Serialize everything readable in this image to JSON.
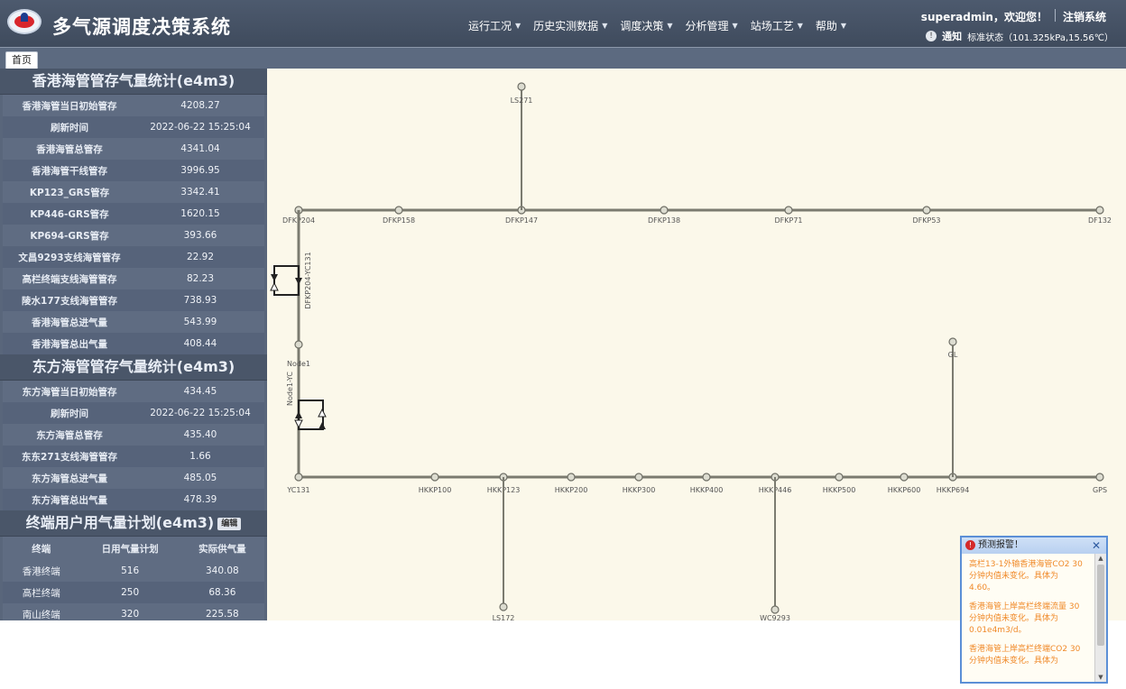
{
  "app": {
    "title": "多气源调度决策系统",
    "menu": [
      "运行工况",
      "历史实测数据",
      "调度决策",
      "分析管理",
      "站场工艺",
      "帮助"
    ],
    "user_greeting": "superadmin，欢迎您！",
    "logout_label": "注销系统",
    "notice_label": "通知",
    "status_text": "标准状态（101.325kPa,15.56℃）"
  },
  "tabs": [
    {
      "label": "首页"
    }
  ],
  "hk_panel": {
    "title": "香港海管管存气量统计(e4m3)",
    "rows": [
      {
        "label": "香港海管当日初始管存",
        "value": "4208.27"
      },
      {
        "label": "刷新时间",
        "value": "2022-06-22 15:25:04"
      },
      {
        "label": "香港海管总管存",
        "value": "4341.04"
      },
      {
        "label": "香港海管干线管存",
        "value": "3996.95"
      },
      {
        "label": "KP123_GRS管存",
        "value": "3342.41"
      },
      {
        "label": "KP446-GRS管存",
        "value": "1620.15"
      },
      {
        "label": "KP694-GRS管存",
        "value": "393.66"
      },
      {
        "label": "文昌9293支线海管管存",
        "value": "22.92"
      },
      {
        "label": "高栏终端支线海管管存",
        "value": "82.23"
      },
      {
        "label": "陵水177支线海管管存",
        "value": "738.93"
      },
      {
        "label": "香港海管总进气量",
        "value": "543.99"
      },
      {
        "label": "香港海管总出气量",
        "value": "408.44"
      }
    ]
  },
  "df_panel": {
    "title": "东方海管管存气量统计(e4m3)",
    "rows": [
      {
        "label": "东方海管当日初始管存",
        "value": "434.45"
      },
      {
        "label": "刷新时间",
        "value": "2022-06-22 15:25:04"
      },
      {
        "label": "东方海管总管存",
        "value": "435.40"
      },
      {
        "label": "东东271支线海管管存",
        "value": "1.66"
      },
      {
        "label": "东方海管总进气量",
        "value": "485.05"
      },
      {
        "label": "东方海管总出气量",
        "value": "478.39"
      }
    ]
  },
  "user_panel": {
    "title": "终端用户用气量计划(e4m3)",
    "edit_label": "编辑",
    "headers": [
      "终端",
      "日用气量计划",
      "实际供气量"
    ],
    "rows": [
      {
        "terminal": "香港终端",
        "plan": "516",
        "actual": "340.08"
      },
      {
        "terminal": "高栏终端",
        "plan": "250",
        "actual": "68.36"
      },
      {
        "terminal": "南山终端",
        "plan": "320",
        "actual": "225.58"
      }
    ]
  },
  "diagram": {
    "top_nodes": [
      "DFKP204",
      "DFKP158",
      "DFKP147",
      "DFKP138",
      "DFKP71",
      "DFKP53",
      "DF132"
    ],
    "top_branch": "LS271",
    "mid_node": "Node1",
    "bottom_nodes": [
      "YC131",
      "HKKP100",
      "HKKP123",
      "HKKP200",
      "HKKP300",
      "HKKP400",
      "HKKP446",
      "HKKP500",
      "HKKP600",
      "HKKP694",
      "GPS"
    ],
    "branch_ls": "LS172",
    "branch_wc": "WC9293",
    "branch_gl": "GL",
    "vertical_label_top": "DFKP204-YC131",
    "vertical_label_mid": "Node1-YC"
  },
  "alarm": {
    "title": "预测报警！",
    "messages": [
      "高栏13-1外输香港海管CO2 30分钟内值未变化。具体为 4.60。",
      "香港海管上岸高栏终端流量 30分钟内值未变化。具体为 0.01e4m3/d。",
      "香港海管上岸高栏终端CO2 30分钟内值未变化。具体为"
    ]
  }
}
